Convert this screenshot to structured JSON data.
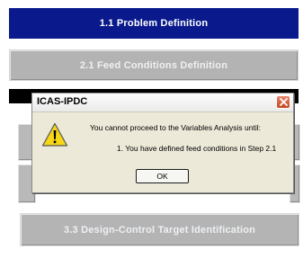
{
  "steps": {
    "problem_definition": "1.1 Problem Definition",
    "feed_conditions": "2.1 Feed Conditions Definition",
    "design_control": "3.3 Design-Control Target Identification"
  },
  "dialog": {
    "title": "ICAS-IPDC",
    "message_line1": "You cannot proceed to the Variables Analysis until:",
    "message_line2": "1. You have defined feed conditions in Step 2.1",
    "ok_label": "OK",
    "icon": "warning-icon"
  },
  "colors": {
    "active_step": "#0a1a8c",
    "inactive_step": "#b3b3b3",
    "close_button": "#c4451f"
  }
}
